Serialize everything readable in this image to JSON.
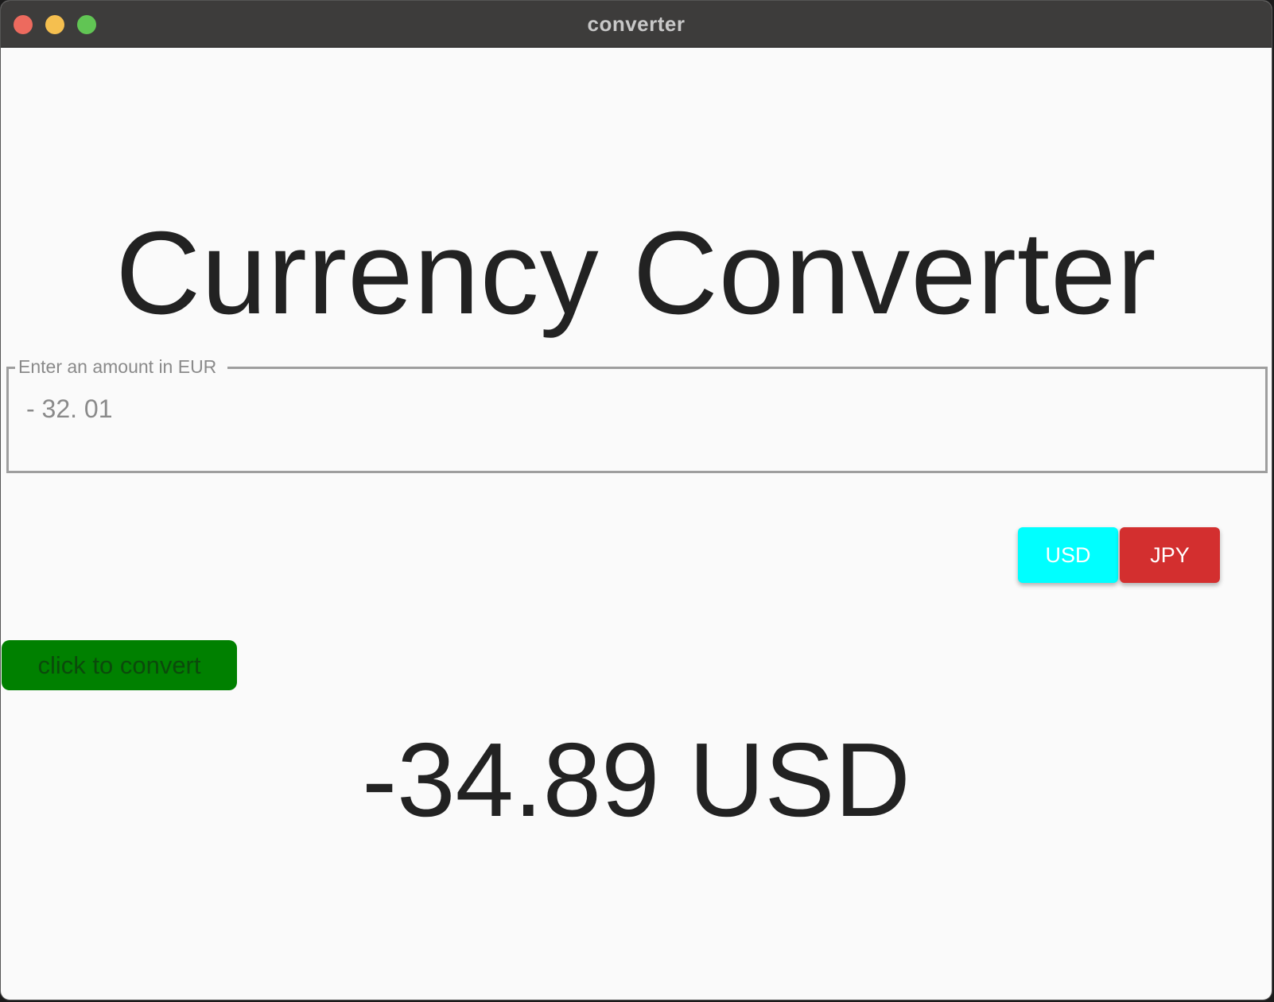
{
  "window": {
    "title": "converter"
  },
  "app": {
    "heading": "Currency Converter",
    "amount_field": {
      "label": "Enter an amount in EUR",
      "value": "- 32. 01"
    },
    "currency_buttons": [
      {
        "label": "USD",
        "color": "#00ffff"
      },
      {
        "label": "JPY",
        "color": "#d32f2f"
      }
    ],
    "convert_button": {
      "label": "click to convert",
      "color": "#008000"
    },
    "result": "-34.89 USD"
  }
}
